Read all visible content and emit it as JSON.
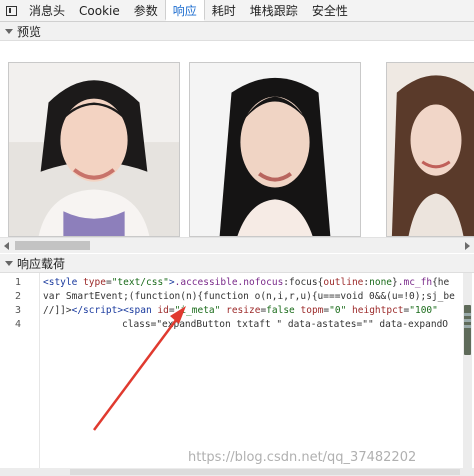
{
  "tabs": [
    {
      "label": "消息头"
    },
    {
      "label": "Cookie"
    },
    {
      "label": "参数"
    },
    {
      "label": "响应",
      "active": true
    },
    {
      "label": "耗时"
    },
    {
      "label": "堆栈跟踪"
    },
    {
      "label": "安全性"
    }
  ],
  "preview": {
    "title": "预览"
  },
  "response_payload": {
    "title": "响应载荷"
  },
  "code": {
    "line_numbers": [
      "1",
      "2",
      "3",
      "4"
    ]
  },
  "watermark": "https://blog.csdn.net/qq_37482202",
  "colors": {
    "active_tab": "#1f6fd0",
    "arrow": "#e03a2f"
  },
  "icons": {
    "panel_toggle": "panel-toggle-icon"
  }
}
